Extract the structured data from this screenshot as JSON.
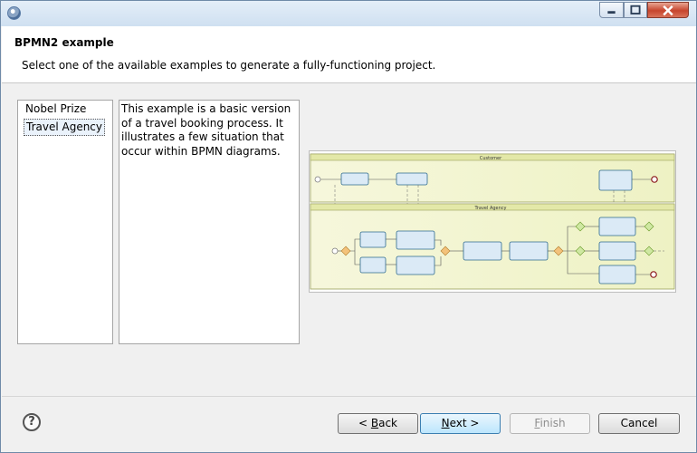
{
  "wizard": {
    "title": "BPMN2 example",
    "description": "Select one of the available examples to generate a fully-functioning project."
  },
  "examples": {
    "items": [
      {
        "label": "Nobel Prize",
        "selected": false
      },
      {
        "label": "Travel Agency",
        "selected": true
      }
    ],
    "description": "This example is a basic version of a travel booking process. It illustrates a few situation that occur within BPMN diagrams."
  },
  "diagram": {
    "pool_customer": "Customer",
    "pool_travel_agency": "Travel Agency",
    "colors": {
      "pool_fill": "#f3f5d0",
      "task_fill": "#dbeaf6",
      "task_border": "#2d6a8f",
      "gateway": "#f3c27b",
      "end_event": "#8b1a1a"
    }
  },
  "buttons": {
    "back": {
      "prefix": "< ",
      "accel": "B",
      "rest": "ack"
    },
    "next": {
      "accel": "N",
      "rest": "ext >"
    },
    "finish": {
      "accel": "F",
      "rest": "inish"
    },
    "cancel": "Cancel"
  },
  "icons": {
    "app": "eclipse-icon",
    "help": "help-icon",
    "minimize": "minimize-icon",
    "maximize": "maximize-icon",
    "close": "close-icon"
  }
}
